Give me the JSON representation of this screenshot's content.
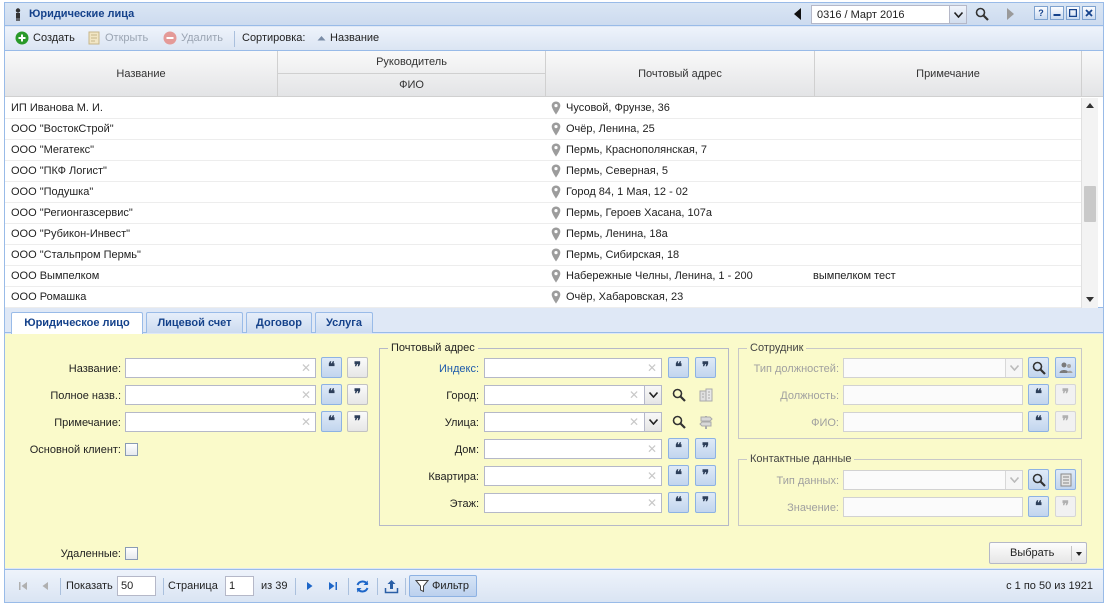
{
  "header": {
    "title": "Юридические лица",
    "period": "0316 / Март 2016"
  },
  "toolbar": {
    "create": "Создать",
    "open": "Открыть",
    "delete": "Удалить",
    "sort_label": "Сортировка:",
    "sort_field": "Название"
  },
  "grid": {
    "columns": {
      "name": "Название",
      "head_group": "Руководитель",
      "head_fio": "ФИО",
      "address": "Почтовый адрес",
      "note": "Примечание"
    },
    "rows": [
      {
        "name": "ИП Иванова М. И.",
        "address": "Чусовой, Фрунзе, 36",
        "note": ""
      },
      {
        "name": "ООО \"ВостокСтрой\"",
        "address": "Очёр, Ленина, 25",
        "note": ""
      },
      {
        "name": "ООО \"Мегатекс\"",
        "address": "Пермь, Краснополянская, 7",
        "note": ""
      },
      {
        "name": "ООО \"ПКФ Логист\"",
        "address": "Пермь, Северная, 5",
        "note": ""
      },
      {
        "name": "ООО \"Подушка\"",
        "address": "Город 84, 1 Мая, 12 - 02",
        "note": ""
      },
      {
        "name": "ООО \"Регионгазсервис\"",
        "address": "Пермь, Героев Хасана, 107а",
        "note": ""
      },
      {
        "name": "ООО \"Рубикон-Инвест\"",
        "address": "Пермь, Ленина, 18а",
        "note": ""
      },
      {
        "name": "ООО \"Стальпром Пермь\"",
        "address": "Пермь, Сибирская, 18",
        "note": ""
      },
      {
        "name": "ООО Вымпелком",
        "address": "Набережные Челны, Ленина, 1 - 200",
        "note": "вымпелком тест"
      },
      {
        "name": "ООО Ромашка",
        "address": "Очёр, Хабаровская, 23",
        "note": ""
      }
    ]
  },
  "tabs": [
    "Юридическое лицо",
    "Лицевой счет",
    "Договор",
    "Услуга"
  ],
  "form": {
    "name_label": "Название:",
    "fullname_label": "Полное назв.:",
    "note_label": "Примечание:",
    "main_client_label": "Основной клиент:",
    "deleted_label": "Удаленные:",
    "postal": {
      "legend": "Почтовый адрес",
      "index": "Индекс:",
      "city": "Город:",
      "street": "Улица:",
      "house": "Дом:",
      "apartment": "Квартира:",
      "floor": "Этаж:"
    },
    "employee": {
      "legend": "Сотрудник",
      "position_type": "Тип должностей:",
      "position": "Должность:",
      "fio": "ФИО:"
    },
    "contacts": {
      "legend": "Контактные данные",
      "data_type": "Тип данных:",
      "value": "Значение:"
    },
    "select_button": "Выбрать"
  },
  "paging": {
    "show_label": "Показать",
    "page_size": "50",
    "page_label": "Страница",
    "page": "1",
    "of_pages": "из 39",
    "filter": "Фильтр",
    "summary": "с 1 по 50 из 1921"
  },
  "colors": {
    "accent_blue": "#15428b",
    "form_bg": "#fafaca",
    "create_green": "#2a9a2a",
    "delete_red": "#d9534f"
  }
}
